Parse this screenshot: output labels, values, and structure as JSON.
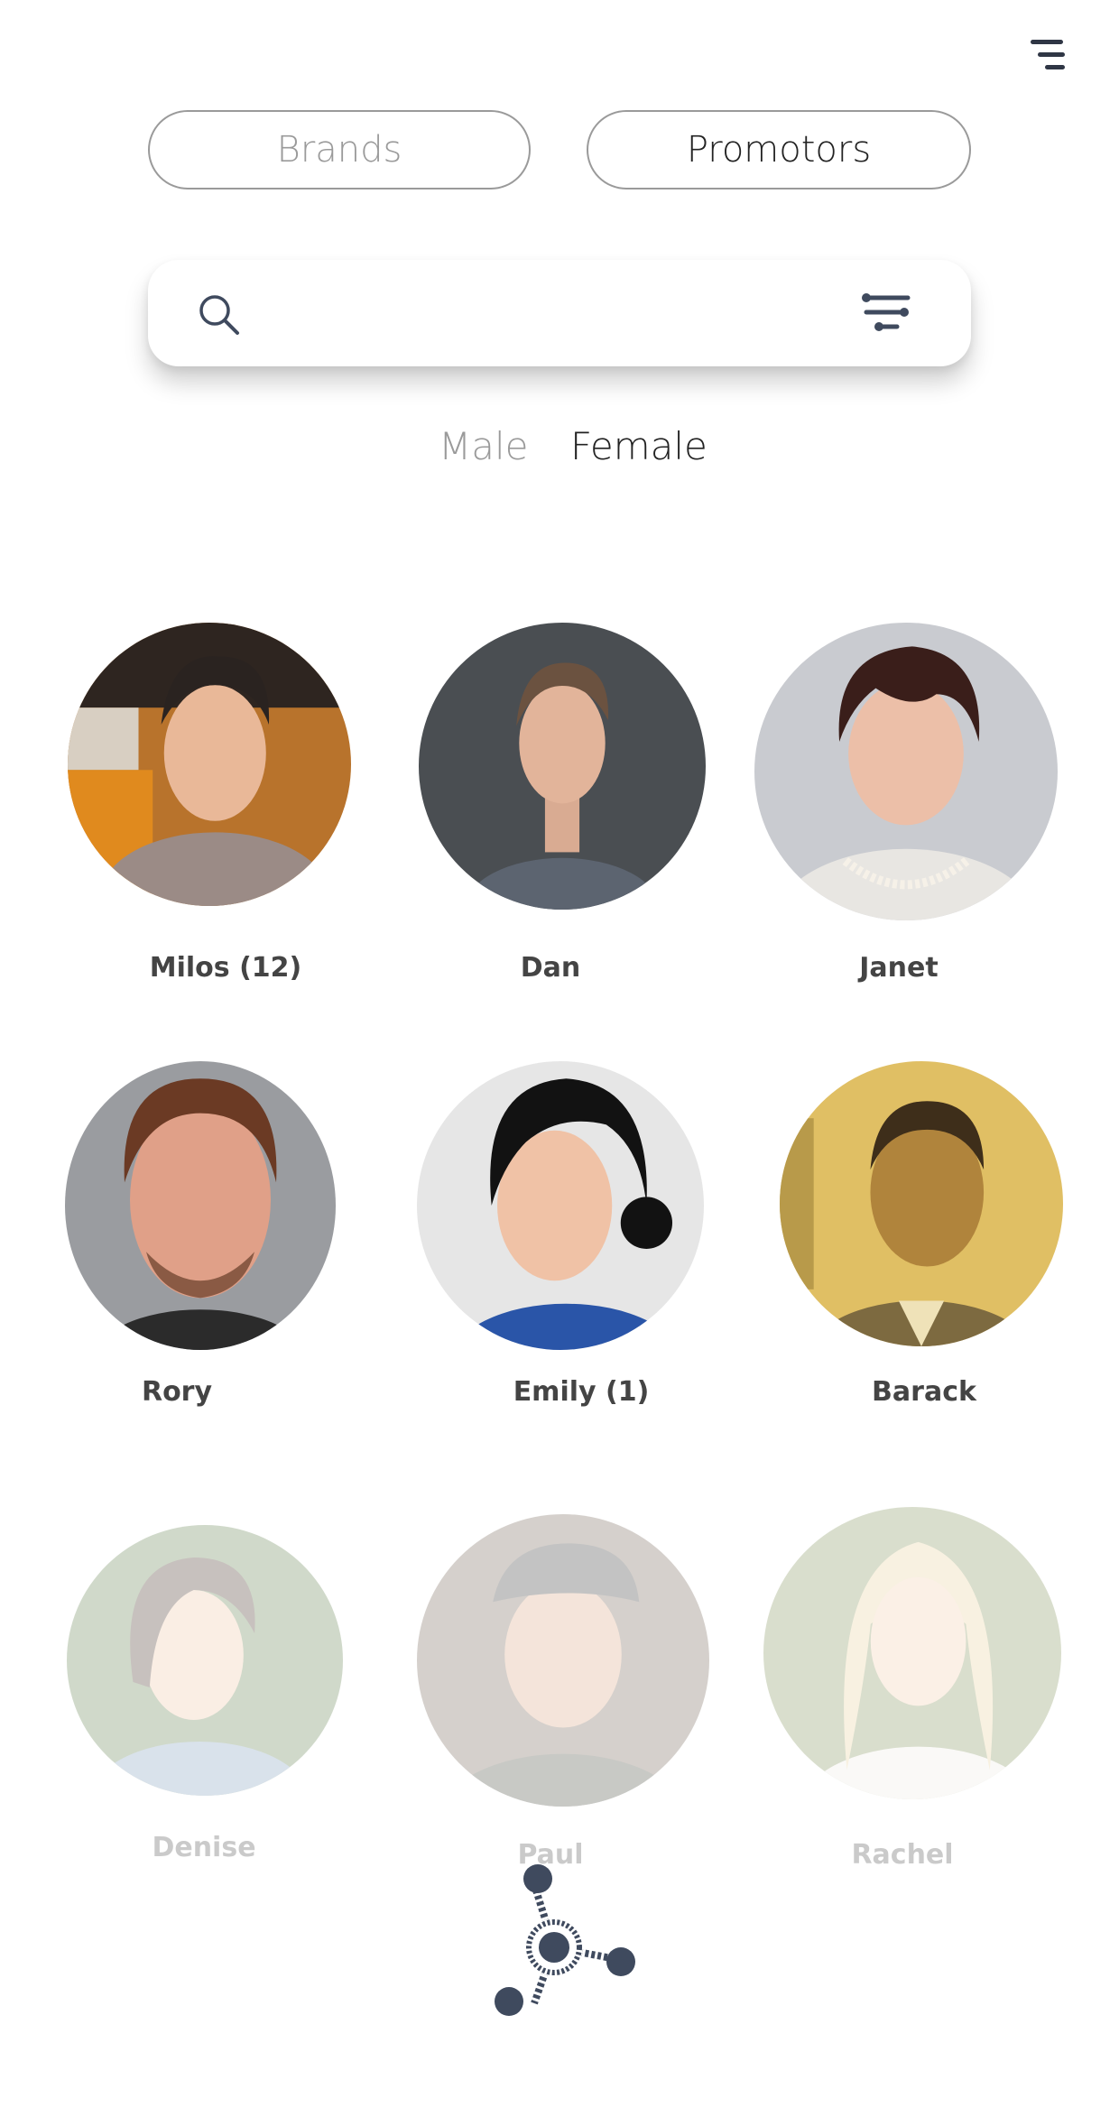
{
  "header": {
    "menu_icon": "hamburger-menu-icon"
  },
  "tabs": [
    {
      "label": "Brands",
      "active": false
    },
    {
      "label": "Promotors",
      "active": true
    }
  ],
  "search": {
    "value": "",
    "placeholder": "",
    "search_icon": "search-icon",
    "filter_icon": "filter-icon"
  },
  "gender_filter": {
    "male": "Male",
    "female": "Female",
    "selected": "Female"
  },
  "people": [
    {
      "name": "Milos (12)",
      "faded": false
    },
    {
      "name": "Dan",
      "faded": false
    },
    {
      "name": "Janet",
      "faded": false
    },
    {
      "name": "Rory",
      "faded": false
    },
    {
      "name": "Emily (1)",
      "faded": false
    },
    {
      "name": "Barack",
      "faded": false
    },
    {
      "name": "Denise",
      "faded": true
    },
    {
      "name": "Paul",
      "faded": true
    },
    {
      "name": "Rachel",
      "faded": true
    }
  ],
  "colors": {
    "accent": "#3f4a5e",
    "active_text": "#222222",
    "inactive_text": "#9a9a9a",
    "name_text": "#444444"
  },
  "footer": {
    "logo_icon": "network-logo-icon"
  }
}
